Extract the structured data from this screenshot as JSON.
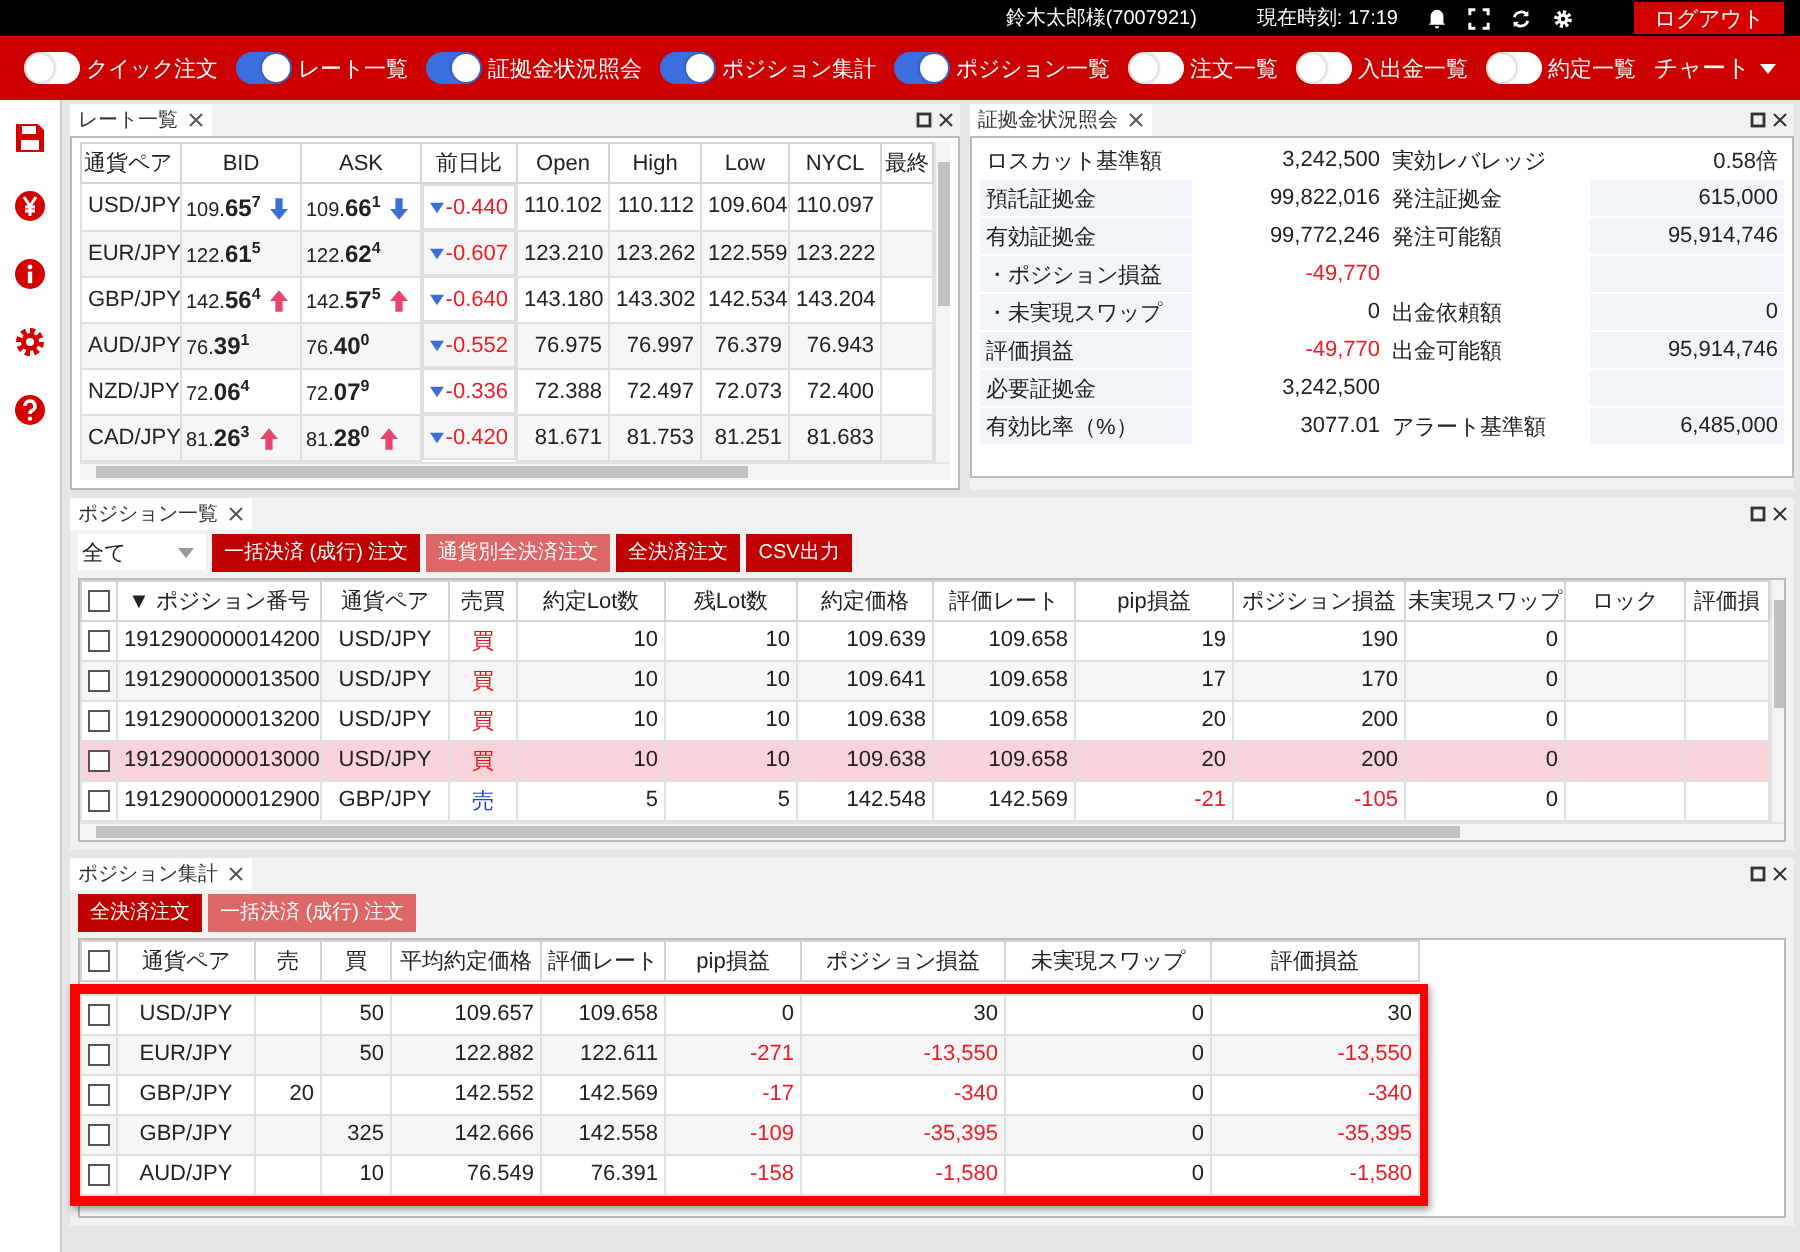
{
  "header": {
    "user": "鈴木太郎様(7007921)",
    "time": "現在時刻: 17:19",
    "logout": "ログアウト"
  },
  "toolbar": {
    "toggles": [
      {
        "label": "クイック注文",
        "on": false
      },
      {
        "label": "レート一覧",
        "on": true
      },
      {
        "label": "証拠金状況照会",
        "on": true
      },
      {
        "label": "ポジション集計",
        "on": true
      },
      {
        "label": "ポジション一覧",
        "on": true
      },
      {
        "label": "注文一覧",
        "on": false
      },
      {
        "label": "入出金一覧",
        "on": false
      },
      {
        "label": "約定一覧",
        "on": false
      }
    ],
    "chart_menu": "チャート"
  },
  "rates": {
    "title": "レート一覧",
    "columns": [
      "通貨ペア",
      "BID",
      "ASK",
      "前日比",
      "Open",
      "High",
      "Low",
      "NYCL",
      "最終"
    ],
    "rows": [
      {
        "pair": "USD/JPY",
        "bid": {
          "lead": "109.",
          "big": "65",
          "pip": "7",
          "rising": false,
          "falling": true
        },
        "ask": {
          "lead": "109.",
          "big": "66",
          "pip": "1",
          "rising": false,
          "falling": true
        },
        "change_down": true,
        "change": "-0.440",
        "open": "110.102",
        "high": "110.112",
        "low": "109.604",
        "nycl": "110.097"
      },
      {
        "pair": "EUR/JPY",
        "bid": {
          "lead": "122.",
          "big": "61",
          "pip": "5",
          "rising": false,
          "falling": false
        },
        "ask": {
          "lead": "122.",
          "big": "62",
          "pip": "4",
          "rising": false,
          "falling": false
        },
        "change_down": true,
        "change": "-0.607",
        "open": "123.210",
        "high": "123.262",
        "low": "122.559",
        "nycl": "123.222"
      },
      {
        "pair": "GBP/JPY",
        "bid": {
          "lead": "142.",
          "big": "56",
          "pip": "4",
          "rising": true,
          "falling": false
        },
        "ask": {
          "lead": "142.",
          "big": "57",
          "pip": "5",
          "rising": true,
          "falling": false
        },
        "change_down": true,
        "change": "-0.640",
        "open": "143.180",
        "high": "143.302",
        "low": "142.534",
        "nycl": "143.204"
      },
      {
        "pair": "AUD/JPY",
        "bid": {
          "lead": "76.",
          "big": "39",
          "pip": "1",
          "rising": false,
          "falling": false
        },
        "ask": {
          "lead": "76.",
          "big": "40",
          "pip": "0",
          "rising": false,
          "falling": false
        },
        "change_down": true,
        "change": "-0.552",
        "open": "76.975",
        "high": "76.997",
        "low": "76.379",
        "nycl": "76.943"
      },
      {
        "pair": "NZD/JPY",
        "bid": {
          "lead": "72.",
          "big": "06",
          "pip": "4",
          "rising": false,
          "falling": false
        },
        "ask": {
          "lead": "72.",
          "big": "07",
          "pip": "9",
          "rising": false,
          "falling": false
        },
        "change_down": true,
        "change": "-0.336",
        "open": "72.388",
        "high": "72.497",
        "low": "72.073",
        "nycl": "72.400"
      },
      {
        "pair": "CAD/JPY",
        "bid": {
          "lead": "81.",
          "big": "26",
          "pip": "3",
          "rising": true,
          "falling": false
        },
        "ask": {
          "lead": "81.",
          "big": "28",
          "pip": "0",
          "rising": true,
          "falling": false
        },
        "change_down": true,
        "change": "-0.420",
        "open": "81.671",
        "high": "81.753",
        "low": "81.251",
        "nycl": "81.683"
      }
    ]
  },
  "margin": {
    "title": "証拠金状況照会",
    "rows": [
      {
        "label": "ロスカット基準額",
        "value": "3,242,500",
        "loss": false,
        "label2": "実効レバレッジ",
        "value2": "0.58倍"
      },
      {
        "label": "預託証拠金",
        "value": "99,822,016",
        "loss": false,
        "label2": "発注証拠金",
        "value2": "615,000"
      },
      {
        "label": "有効証拠金",
        "value": "99,772,246",
        "loss": false,
        "label2": "発注可能額",
        "value2": "95,914,746"
      },
      {
        "label": "・ポジション損益",
        "value": "-49,770",
        "loss": true
      },
      {
        "label": "・未実現スワップ",
        "value": "0",
        "loss": false,
        "label2": "出金依頼額",
        "value2": "0"
      },
      {
        "label": "評価損益",
        "value": "-49,770",
        "loss": true,
        "label2": "出金可能額",
        "value2": "95,914,746"
      },
      {
        "label": "必要証拠金",
        "value": "3,242,500",
        "loss": false
      },
      {
        "label": "有効比率（%）",
        "value": "3077.01",
        "loss": false,
        "label2": "アラート基準額",
        "value2": "6,485,000"
      }
    ]
  },
  "positions": {
    "title": "ポジション一覧",
    "filter": "全て",
    "buttons": [
      {
        "label": "一括決済 (成行) 注文",
        "disabled": false
      },
      {
        "label": "通貨別全決済注文",
        "disabled": true
      },
      {
        "label": "全決済注文",
        "disabled": false
      },
      {
        "label": "CSV出力",
        "disabled": false
      }
    ],
    "select_all_checked": false,
    "columns": [
      "▼ ポジション番号",
      "通貨ペア",
      "売買",
      "約定Lot数",
      "残Lot数",
      "約定価格",
      "評価レート",
      "pip損益",
      "ポジション損益",
      "未実現スワップ",
      "ロック",
      "評価損"
    ],
    "rows": [
      {
        "checked": false,
        "selected": false,
        "id": "1912900000014200",
        "pair": "USD/JPY",
        "kind": "buy",
        "side": "買",
        "lots": "10",
        "remaining": "10",
        "price": "109.639",
        "rate": "109.658",
        "pip": "19",
        "pnl": "190",
        "swap": "0",
        "loss": false
      },
      {
        "checked": false,
        "selected": false,
        "id": "1912900000013500",
        "pair": "USD/JPY",
        "kind": "buy",
        "side": "買",
        "lots": "10",
        "remaining": "10",
        "price": "109.641",
        "rate": "109.658",
        "pip": "17",
        "pnl": "170",
        "swap": "0",
        "loss": false
      },
      {
        "checked": false,
        "selected": false,
        "id": "1912900000013200",
        "pair": "USD/JPY",
        "kind": "buy",
        "side": "買",
        "lots": "10",
        "remaining": "10",
        "price": "109.638",
        "rate": "109.658",
        "pip": "20",
        "pnl": "200",
        "swap": "0",
        "loss": false
      },
      {
        "checked": false,
        "selected": true,
        "id": "1912900000013000",
        "pair": "USD/JPY",
        "kind": "buy",
        "side": "買",
        "lots": "10",
        "remaining": "10",
        "price": "109.638",
        "rate": "109.658",
        "pip": "20",
        "pnl": "200",
        "swap": "0",
        "loss": false
      },
      {
        "checked": false,
        "selected": false,
        "id": "1912900000012900",
        "pair": "GBP/JPY",
        "kind": "sell",
        "side": "売",
        "lots": "5",
        "remaining": "5",
        "price": "142.548",
        "rate": "142.569",
        "pip": "-21",
        "pnl": "-105",
        "swap": "0",
        "loss": true
      }
    ]
  },
  "summary": {
    "title": "ポジション集計",
    "buttons": [
      {
        "label": "全決済注文",
        "disabled": false
      },
      {
        "label": "一括決済 (成行) 注文",
        "disabled": true
      }
    ],
    "select_all_checked": false,
    "columns": [
      "通貨ペア",
      "売",
      "買",
      "平均約定価格",
      "評価レート",
      "pip損益",
      "ポジション損益",
      "未実現スワップ",
      "評価損益"
    ],
    "rows": [
      {
        "checked": false,
        "pair": "USD/JPY",
        "buy": "50",
        "avg": "109.657",
        "rate": "109.658",
        "pip": "0",
        "pnl": "30",
        "swap": "0",
        "eval": "30",
        "loss": false
      },
      {
        "checked": false,
        "pair": "EUR/JPY",
        "buy": "50",
        "avg": "122.882",
        "rate": "122.611",
        "pip": "-271",
        "pnl": "-13,550",
        "swap": "0",
        "eval": "-13,550",
        "loss": true
      },
      {
        "checked": false,
        "pair": "GBP/JPY",
        "sell": "20",
        "avg": "142.552",
        "rate": "142.569",
        "pip": "-17",
        "pnl": "-340",
        "swap": "0",
        "eval": "-340",
        "loss": true
      },
      {
        "checked": false,
        "pair": "GBP/JPY",
        "buy": "325",
        "avg": "142.666",
        "rate": "142.558",
        "pip": "-109",
        "pnl": "-35,395",
        "swap": "0",
        "eval": "-35,395",
        "loss": true
      },
      {
        "checked": false,
        "pair": "AUD/JPY",
        "buy": "10",
        "avg": "76.549",
        "rate": "76.391",
        "pip": "-158",
        "pnl": "-1,580",
        "swap": "0",
        "eval": "-1,580",
        "loss": true
      }
    ]
  }
}
